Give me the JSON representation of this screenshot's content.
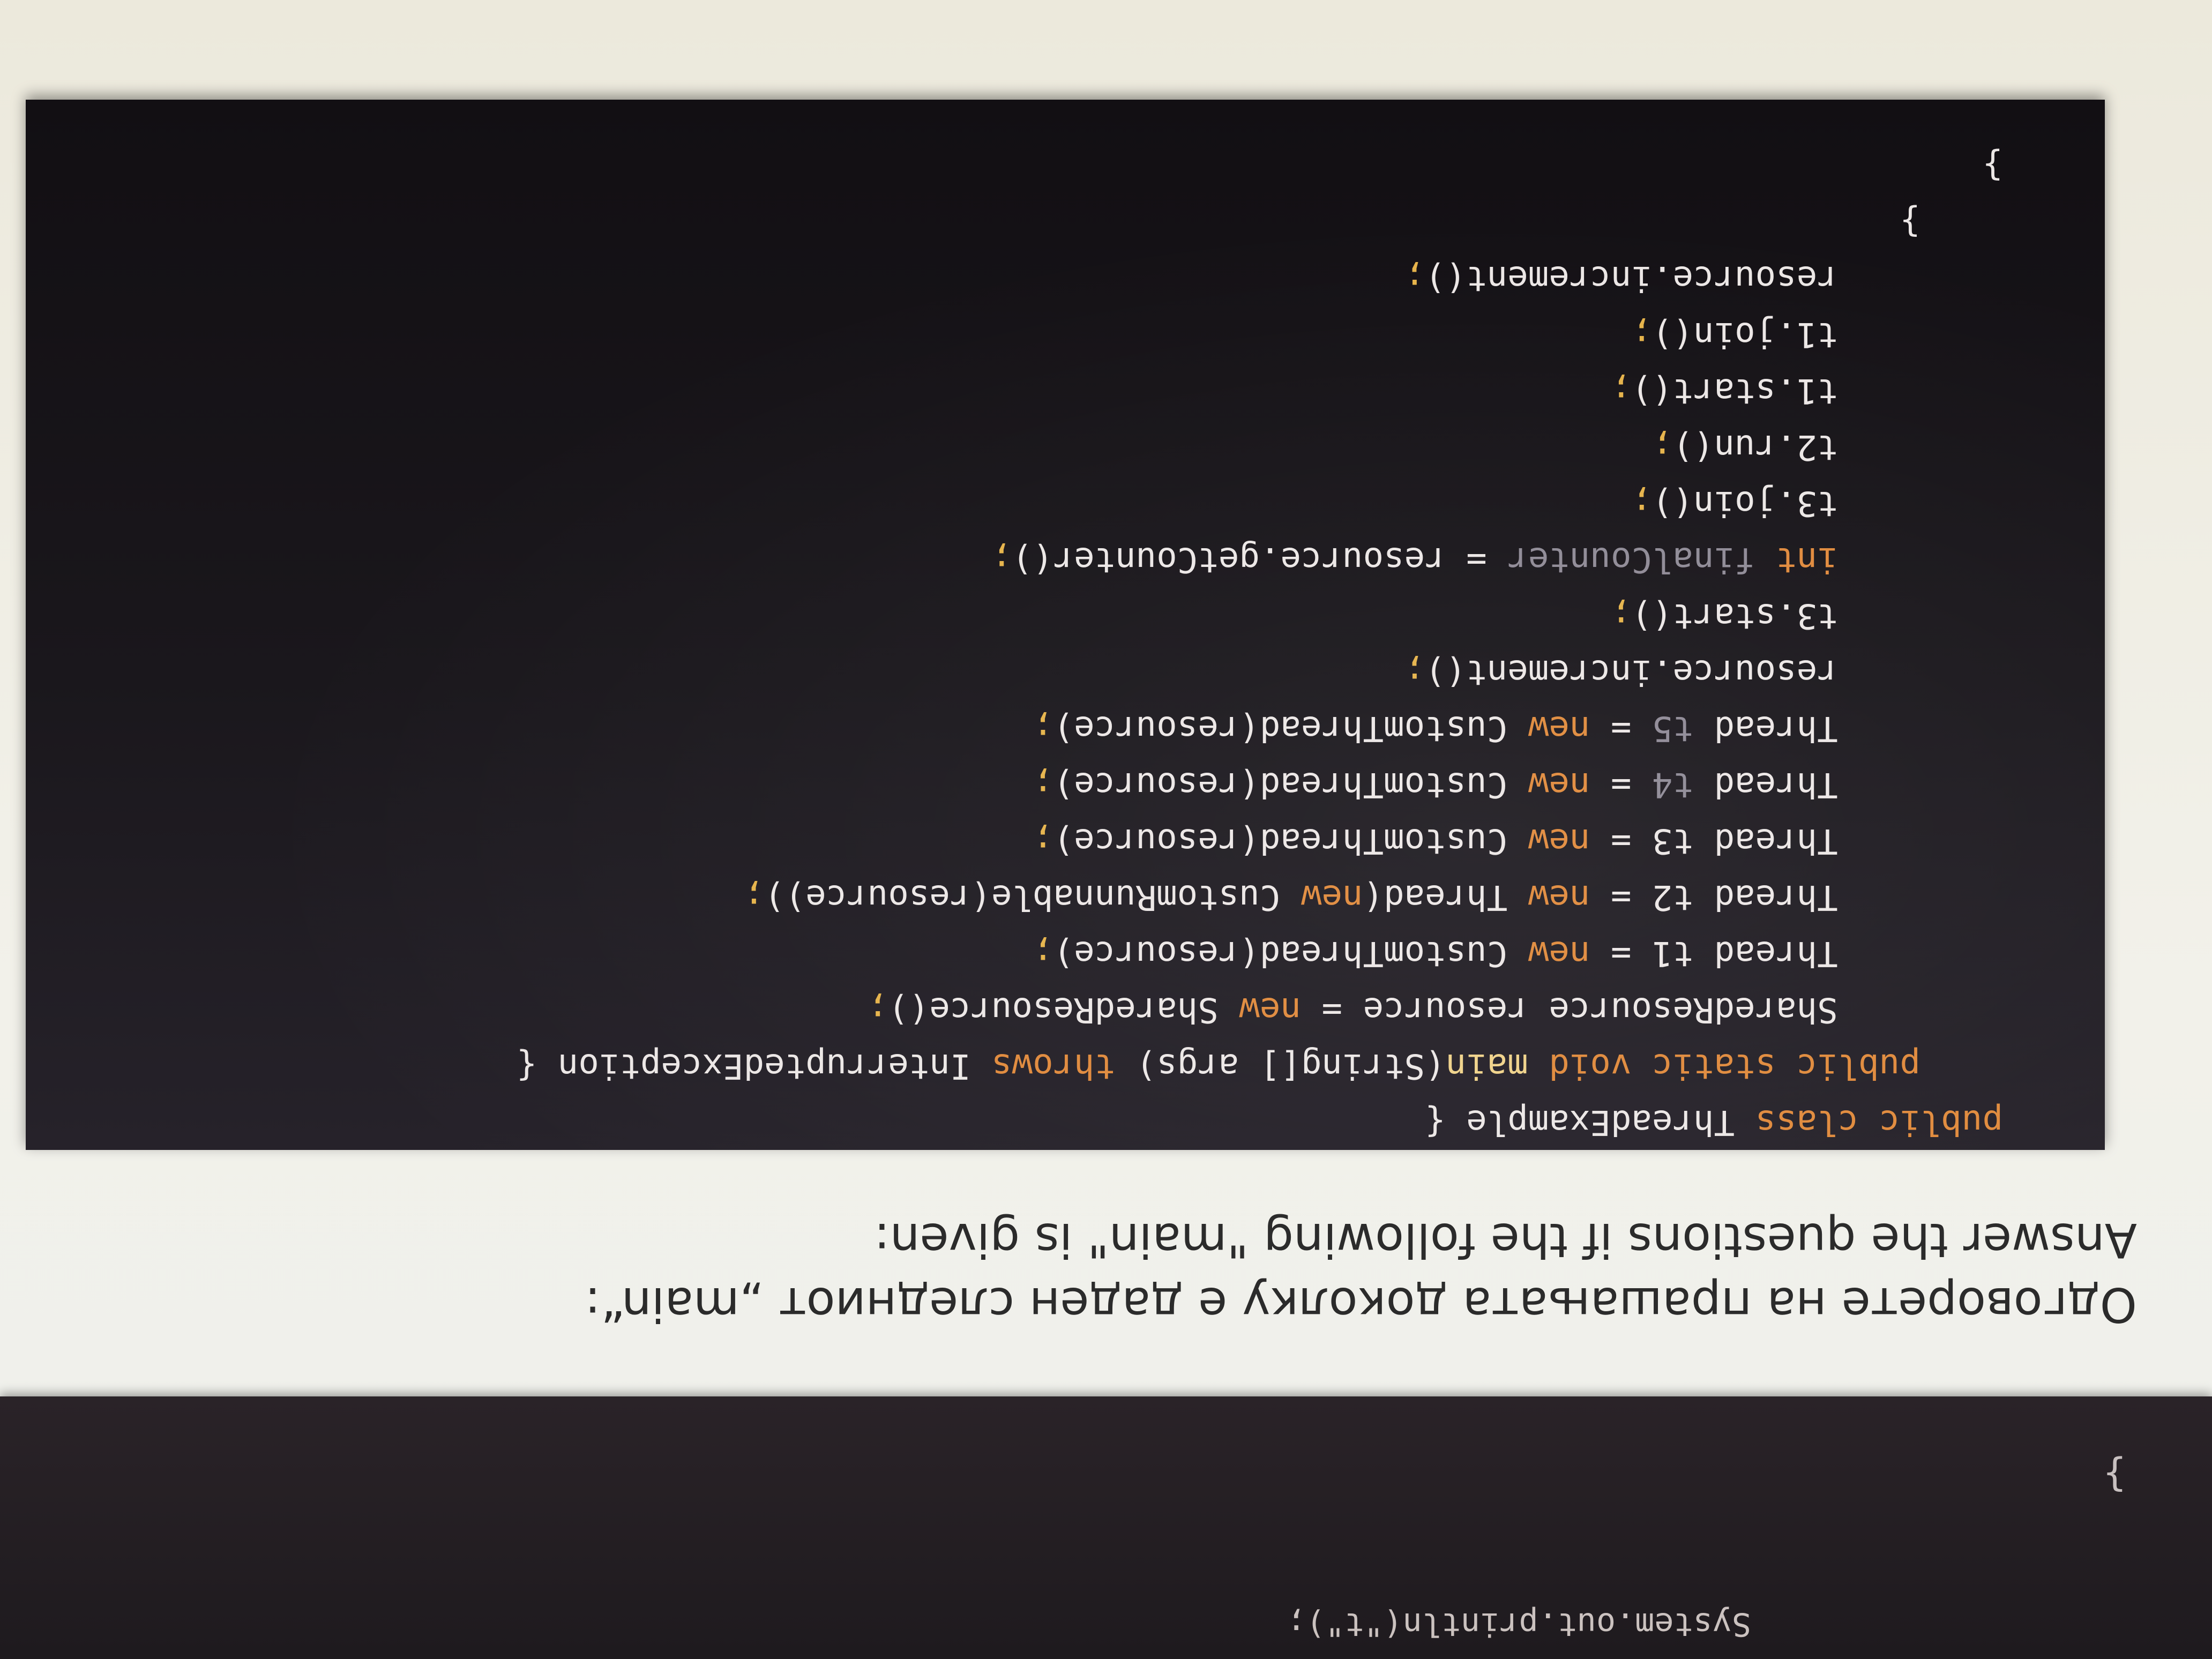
{
  "top_block": {
    "partial_line": "System.out.println(\"t\");",
    "closing_brace": "}"
  },
  "instructions": {
    "macedonian": "Одговорете на прашањата доколку е даден следниот „main“:",
    "english": "Answer the questions if the following \"main\" is given:"
  },
  "code": {
    "lines": [
      [
        {
          "t": "public class ",
          "c": "kw"
        },
        {
          "t": "ThreadExample {",
          "c": ""
        }
      ],
      [
        {
          "t": "    public static void ",
          "c": "kw"
        },
        {
          "t": "main",
          "c": "mth"
        },
        {
          "t": "(String[] args) ",
          "c": ""
        },
        {
          "t": "throws ",
          "c": "kw"
        },
        {
          "t": "InterruptedException {",
          "c": ""
        }
      ],
      [
        {
          "t": "        SharedResource resource = ",
          "c": ""
        },
        {
          "t": "new ",
          "c": "kw"
        },
        {
          "t": "SharedResource()",
          "c": ""
        },
        {
          "t": ";",
          "c": "punc"
        }
      ],
      [
        {
          "t": "        Thread t1 = ",
          "c": ""
        },
        {
          "t": "new ",
          "c": "kw"
        },
        {
          "t": "CustomThread(resource)",
          "c": ""
        },
        {
          "t": ";",
          "c": "punc"
        }
      ],
      [
        {
          "t": "        Thread t2 = ",
          "c": ""
        },
        {
          "t": "new ",
          "c": "kw"
        },
        {
          "t": "Thread(",
          "c": ""
        },
        {
          "t": "new ",
          "c": "kw"
        },
        {
          "t": "CustomRunnable(resource))",
          "c": ""
        },
        {
          "t": ";",
          "c": "punc"
        }
      ],
      [
        {
          "t": "        Thread t3 = ",
          "c": ""
        },
        {
          "t": "new ",
          "c": "kw"
        },
        {
          "t": "CustomThread(resource)",
          "c": ""
        },
        {
          "t": ";",
          "c": "punc"
        }
      ],
      [
        {
          "t": "        Thread ",
          "c": ""
        },
        {
          "t": "t4",
          "c": "fld"
        },
        {
          "t": " = ",
          "c": ""
        },
        {
          "t": "new ",
          "c": "kw"
        },
        {
          "t": "CustomThread(resource)",
          "c": ""
        },
        {
          "t": ";",
          "c": "punc"
        }
      ],
      [
        {
          "t": "        Thread ",
          "c": ""
        },
        {
          "t": "t5",
          "c": "fld"
        },
        {
          "t": " = ",
          "c": ""
        },
        {
          "t": "new ",
          "c": "kw"
        },
        {
          "t": "CustomThread(resource)",
          "c": ""
        },
        {
          "t": ";",
          "c": "punc"
        }
      ],
      [
        {
          "t": "        resource.increment()",
          "c": ""
        },
        {
          "t": ";",
          "c": "punc"
        }
      ],
      [
        {
          "t": "        t3.start()",
          "c": ""
        },
        {
          "t": ";",
          "c": "punc"
        }
      ],
      [
        {
          "t": "        int ",
          "c": "kw"
        },
        {
          "t": "finalCounter",
          "c": "fld"
        },
        {
          "t": " = resource.getCounter()",
          "c": ""
        },
        {
          "t": ";",
          "c": "punc"
        }
      ],
      [
        {
          "t": "        t3.join()",
          "c": ""
        },
        {
          "t": ";",
          "c": "punc"
        }
      ],
      [
        {
          "t": "        t2.run()",
          "c": ""
        },
        {
          "t": ";",
          "c": "punc"
        }
      ],
      [
        {
          "t": "        t1.start()",
          "c": ""
        },
        {
          "t": ";",
          "c": "punc"
        }
      ],
      [
        {
          "t": "        t1.join()",
          "c": ""
        },
        {
          "t": ";",
          "c": "punc"
        }
      ],
      [
        {
          "t": "        resource.increment()",
          "c": ""
        },
        {
          "t": ";",
          "c": "punc"
        }
      ],
      [
        {
          "t": "    }",
          "c": ""
        }
      ],
      [
        {
          "t": "}",
          "c": ""
        }
      ]
    ]
  },
  "colors": {
    "keyword": "#e08a3c",
    "method": "#f0d28a",
    "unused_variable": "#8f8a96",
    "code_background": "#1a171c"
  }
}
